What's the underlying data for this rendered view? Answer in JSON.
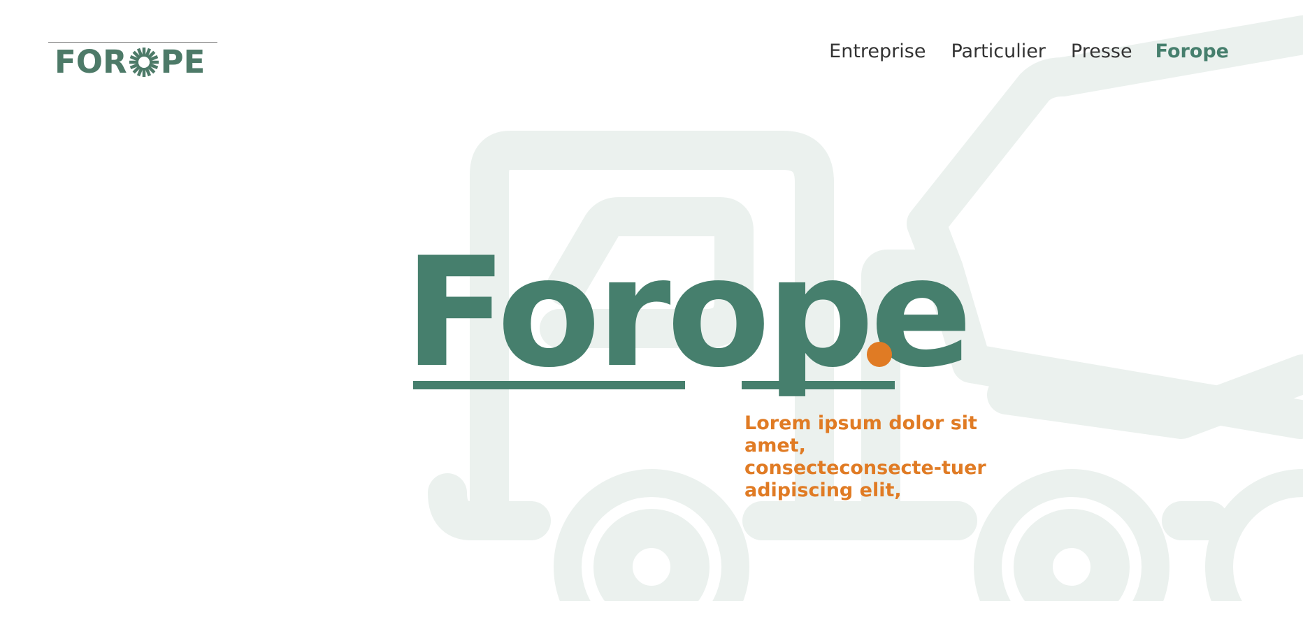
{
  "logo": {
    "text_left": "FOR",
    "text_right": "PE",
    "icon": "sun-burst-icon"
  },
  "nav": {
    "items": [
      {
        "label": "Entreprise"
      },
      {
        "label": "Particulier"
      },
      {
        "label": "Presse"
      },
      {
        "label": "Forope",
        "active": true
      }
    ]
  },
  "hero": {
    "title": "Forope",
    "subtitle": "Lorem ipsum dolor sit amet, consecteconsecte-tuer adipiscing elit,"
  },
  "colors": {
    "primary": "#467f6d",
    "accent": "#e07b24",
    "background_illustration": "#ebf1ee",
    "nav_text": "#333333"
  },
  "illustration": {
    "icon": "concrete-mixer-truck-icon"
  }
}
